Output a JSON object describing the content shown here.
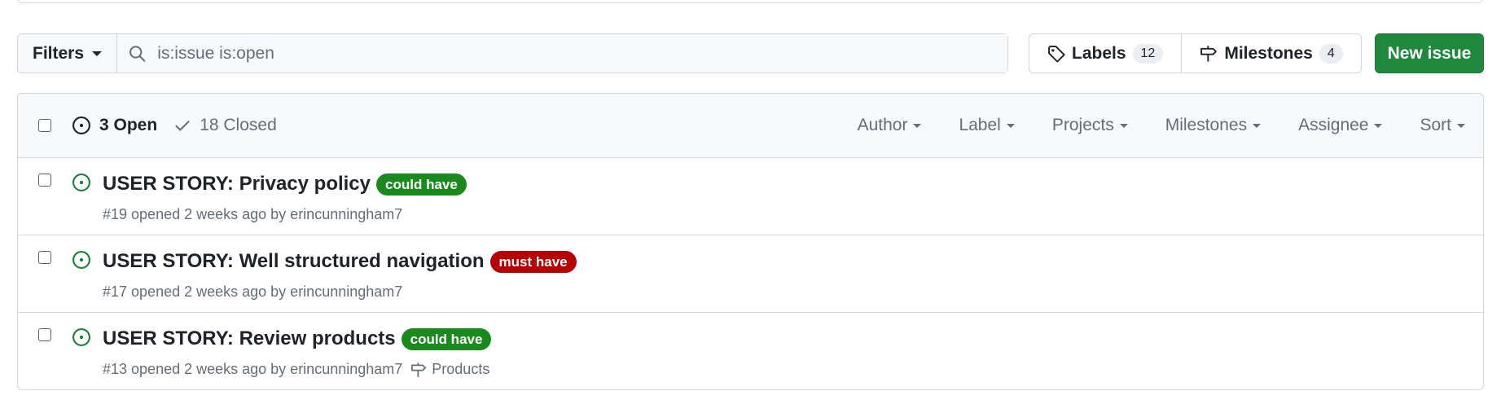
{
  "toolbar": {
    "filters_label": "Filters",
    "search_value": "is:issue is:open",
    "labels_label": "Labels",
    "labels_count": "12",
    "milestones_label": "Milestones",
    "milestones_count": "4",
    "new_issue_label": "New issue"
  },
  "header": {
    "open_label": "3 Open",
    "closed_label": "18 Closed",
    "filters": [
      "Author",
      "Label",
      "Projects",
      "Milestones",
      "Assignee",
      "Sort"
    ]
  },
  "issues": [
    {
      "title": "USER STORY: Privacy policy",
      "label": "could have",
      "label_color": "#1a8a1f",
      "meta": "#19 opened 2 weeks ago by erincunningham7",
      "milestone": ""
    },
    {
      "title": "USER STORY: Well structured navigation",
      "label": "must have",
      "label_color": "#b60205",
      "meta": "#17 opened 2 weeks ago by erincunningham7",
      "milestone": ""
    },
    {
      "title": "USER STORY: Review products",
      "label": "could have",
      "label_color": "#1a8a1f",
      "meta": "#13 opened 2 weeks ago by erincunningham7",
      "milestone": "Products"
    }
  ],
  "colors": {
    "primary_button": "#1f883d",
    "open_icon": "#1a7f37"
  }
}
